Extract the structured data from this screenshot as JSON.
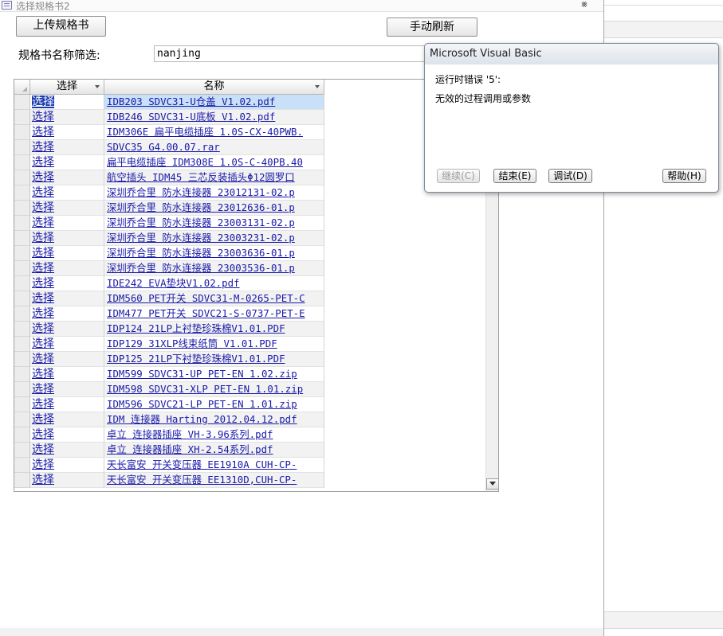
{
  "window": {
    "title": "选择规格书2",
    "close_glyph": "⨳"
  },
  "toolbar": {
    "upload_label": "上传规格书",
    "refresh_label": "手动刷新"
  },
  "filter": {
    "label": "规格书名称筛选:",
    "value": "nanjing"
  },
  "grid": {
    "columns": [
      "选择",
      "名称"
    ],
    "select_label": "选择",
    "rows": [
      "IDB203 SDVC31-U仓盖 V1.02.pdf",
      "IDB246 SDVC31-U底板 V1.02.pdf",
      "IDM306E 扁平电缆插座 1.0S-CX-40PWB.",
      "SDVC35 G4.00.07.rar",
      "扁平电缆插座 IDM308E 1.0S-C-40PB.40",
      "航空插头 IDM45 三芯反装插头Φ12圆罗口",
      "深圳乔合里 防水连接器 23012131-02.p",
      "深圳乔合里 防水连接器 23012636-01.p",
      "深圳乔合里 防水连接器 23003131-02.p",
      "深圳乔合里 防水连接器 23003231-02.p",
      "深圳乔合里 防水连接器 23003636-01.p",
      "深圳乔合里 防水连接器 23003536-01.p",
      "IDE242 EVA垫块V1.02.pdf",
      "IDM560 PET开关 SDVC31-M-0265-PET-C",
      "IDM477 PET开关 SDVC21-S-0737-PET-E",
      "IDP124 21LP上衬垫珍珠棉V1.01.PDF",
      "IDP129 31XLP线束纸筒 V1.01.PDF",
      "IDP125 21LP下衬垫珍珠棉V1.01.PDF",
      "IDM599 SDVC31-UP PET-EN 1.02.zip",
      "IDM598 SDVC31-XLP PET-EN 1.01.zip",
      "IDM596 SDVC21-LP PET-EN 1.01.zip",
      "IDM 连接器 Harting 2012.04.12.pdf",
      "卓立 连接器插座 VH-3.96系列.pdf",
      "卓立 连接器插座 XH-2.54系列.pdf",
      "天长富安 开关变压器 EE1910A CUH-CP-",
      "天长富安 开关变压器 EE1310D,CUH-CP-"
    ]
  },
  "dialog": {
    "title": "Microsoft Visual Basic",
    "error_line": "运行时错误 '5':",
    "message": "无效的过程调用或参数",
    "continue_label": "继续(C)",
    "end_label": "结束(E)",
    "debug_label": "调试(D)",
    "help_label": "帮助(H)"
  },
  "colors": {
    "link": "#1a1aa8",
    "selection": "#1c3bb0",
    "row_highlight": "#c8e0f8"
  }
}
